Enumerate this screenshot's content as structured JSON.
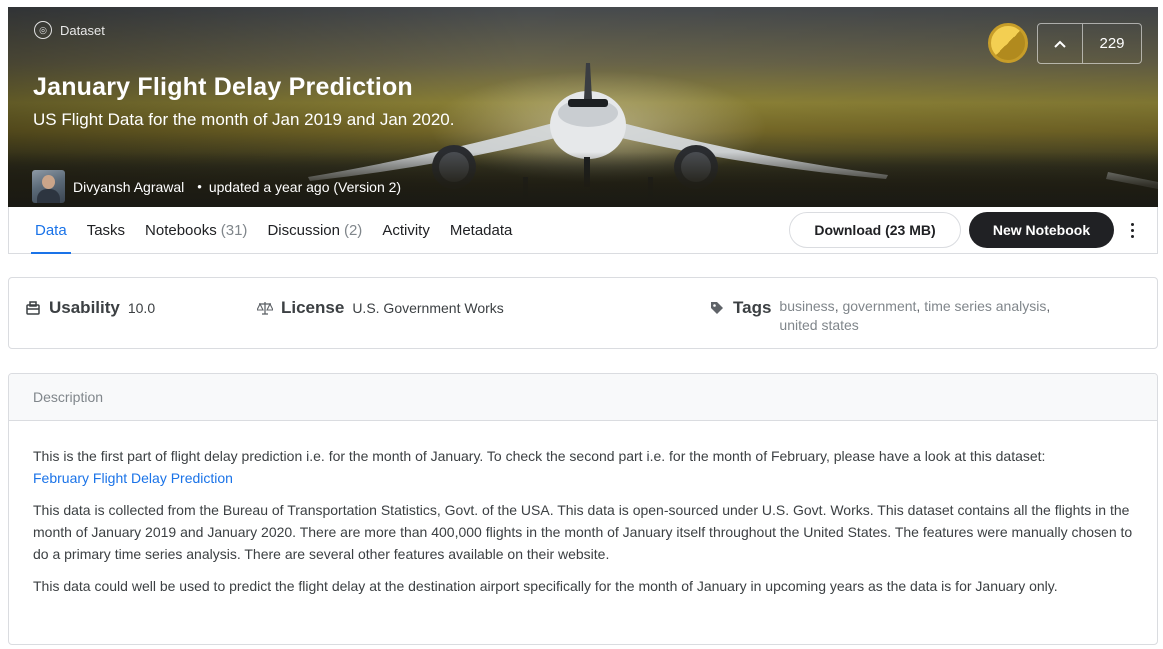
{
  "header": {
    "type_label": "Dataset",
    "title": "January Flight Delay Prediction",
    "subtitle": "US Flight Data for the month of Jan 2019 and Jan 2020.",
    "author": "Divyansh Agrawal",
    "updated": "updated a year ago (Version 2)",
    "votes": "229",
    "medal": "gold"
  },
  "tabs": [
    {
      "label": "Data",
      "count": ""
    },
    {
      "label": "Tasks",
      "count": ""
    },
    {
      "label": "Notebooks",
      "count": "(31)"
    },
    {
      "label": "Discussion",
      "count": "(2)"
    },
    {
      "label": "Activity",
      "count": ""
    },
    {
      "label": "Metadata",
      "count": ""
    }
  ],
  "actions": {
    "download": "Download (23 MB)",
    "new_notebook": "New Notebook"
  },
  "meta": {
    "usability_label": "Usability",
    "usability_value": "10.0",
    "license_label": "License",
    "license_value": "U.S. Government Works",
    "tags_label": "Tags",
    "tags": [
      "business",
      "government",
      "time series analysis",
      "united states"
    ]
  },
  "description": {
    "header": "Description",
    "p1": "This is the first part of flight delay prediction i.e. for the month of January. To check the second part i.e. for the month of February, please have a look at this dataset:",
    "p1_link": "February Flight Delay Prediction",
    "p2": "This data is collected from the Bureau of Transportation Statistics, Govt. of the USA. This data is open-sourced under U.S. Govt. Works. This dataset contains all the flights in the month of January 2019 and January 2020. There are more than 400,000 flights in the month of January itself throughout the United States. The features were manually chosen to do a primary time series analysis. There are several other features available on their website.",
    "p3": "This data could well be used to predict the flight delay at the destination airport specifically for the month of January in upcoming years as the data is for January only."
  },
  "colors": {
    "accent": "#1a73e8",
    "dark_button": "#202124"
  }
}
